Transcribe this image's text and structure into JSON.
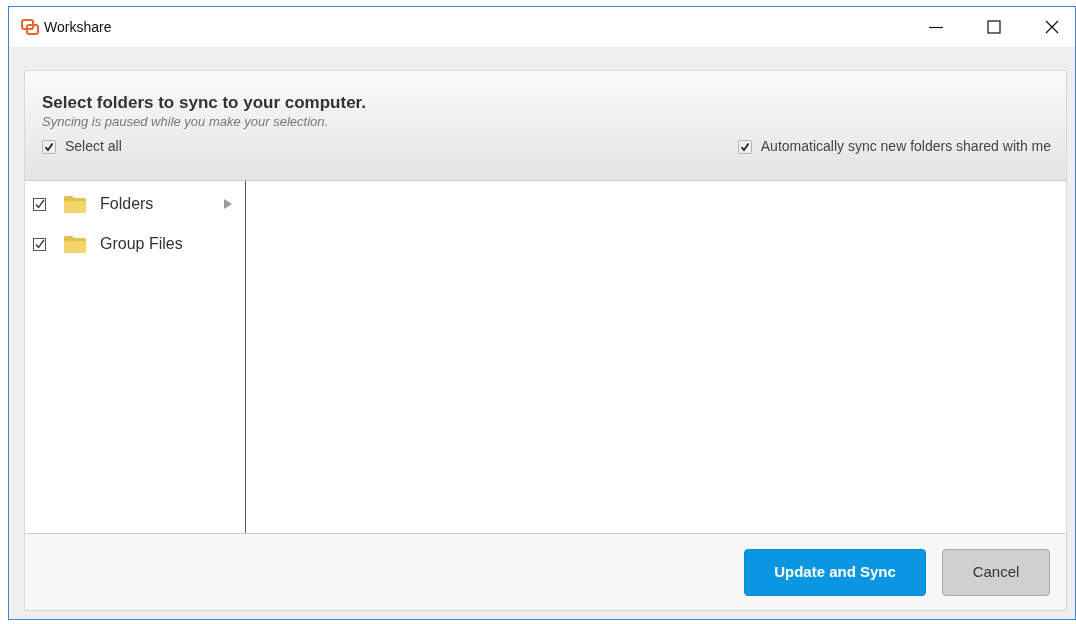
{
  "window": {
    "title": "Workshare"
  },
  "header": {
    "title": "Select folders to sync to your computer.",
    "subtitle": "Syncing is paused while you make your selection.",
    "select_all": {
      "label": "Select all",
      "checked": true
    },
    "auto_sync": {
      "label": "Automatically sync new folders shared with me",
      "checked": true
    }
  },
  "tree": [
    {
      "label": "Folders",
      "checked": true,
      "has_children": true
    },
    {
      "label": "Group Files",
      "checked": true,
      "has_children": false
    }
  ],
  "buttons": [
    {
      "label": "Update and Sync",
      "kind": "primary"
    },
    {
      "label": "Cancel",
      "kind": "secondary"
    }
  ]
}
